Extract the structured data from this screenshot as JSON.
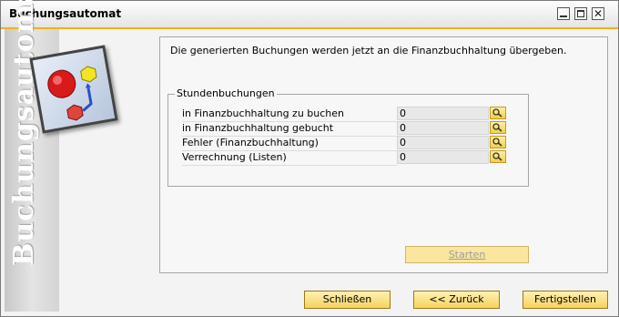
{
  "window": {
    "title": "Buchungsautomat"
  },
  "sidebar": {
    "text": "Buchungsautomat"
  },
  "main": {
    "intro_text": "Die generierten Buchungen werden jetzt an die Finanzbuchhaltung übergeben.",
    "group": {
      "title": "Stundenbuchungen",
      "rows": [
        {
          "label": "in Finanzbuchhaltung zu buchen",
          "value": "0"
        },
        {
          "label": "in Finanzbuchhaltung gebucht",
          "value": "0"
        },
        {
          "label": "Fehler (Finanzbuchhaltung)",
          "value": "0"
        },
        {
          "label": "Verrechnung (Listen)",
          "value": "0"
        }
      ]
    },
    "start_button": "Starten"
  },
  "footer": {
    "close_label": "Schließen",
    "back_label": "<< Zurück",
    "finish_label": "Fertigstellen"
  },
  "colors": {
    "accent": "#f0b21a",
    "button": "#f6d35d"
  },
  "icons": [
    "minimize-icon",
    "maximize-icon",
    "close-icon",
    "wizard-icon",
    "magnifier-icon"
  ]
}
